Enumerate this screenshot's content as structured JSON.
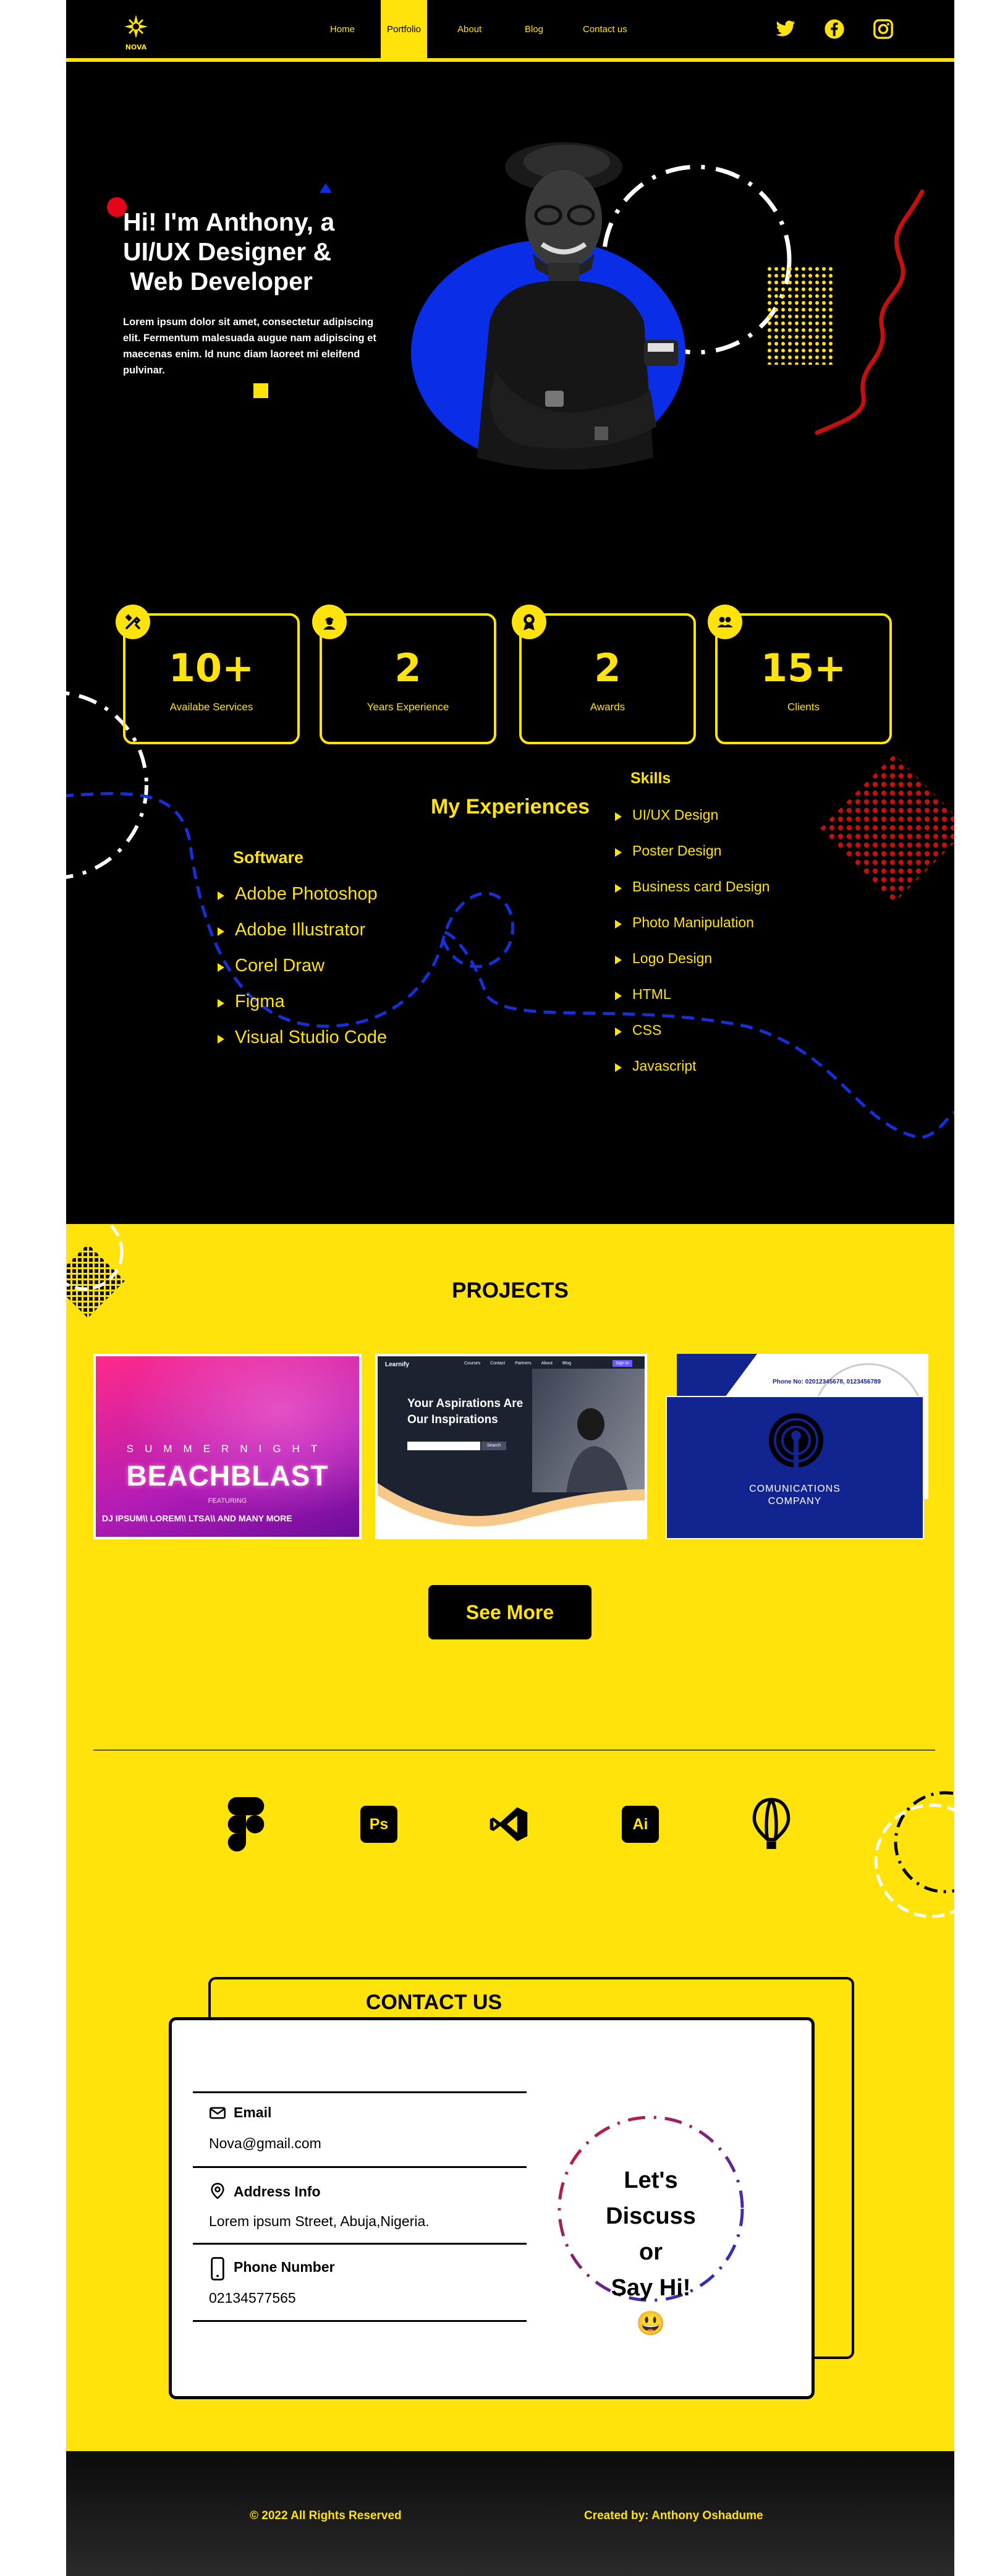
{
  "brand": {
    "name": "NOVA"
  },
  "nav": {
    "items": [
      {
        "label": "Home"
      },
      {
        "label": "Portfolio"
      },
      {
        "label": "About"
      },
      {
        "label": "Blog"
      },
      {
        "label": "Contact us"
      }
    ],
    "active": "Portfolio",
    "social": [
      "twitter-icon",
      "facebook-icon",
      "instagram-icon"
    ]
  },
  "hero": {
    "title_lines": [
      "Hi! I'm Anthony, a",
      "UI/UX Designer &",
      " Web Developer"
    ],
    "description": "Lorem ipsum dolor sit amet, consectetur adipiscing elit. Fermentum malesuada augue nam adipiscing et maecenas enim. Id nunc diam laoreet mi eleifend pulvinar."
  },
  "stats": [
    {
      "value": "10+",
      "label": "Availabe Services",
      "icon": "tools-icon"
    },
    {
      "value": "2",
      "label": "Years Experience",
      "icon": "worker-icon"
    },
    {
      "value": "2",
      "label": "Awards",
      "icon": "award-icon"
    },
    {
      "value": "15+",
      "label": "Clients",
      "icon": "clients-icon"
    }
  ],
  "experiences": {
    "title": "My Experiences",
    "software_title": "Software",
    "software": [
      "Adobe Photoshop",
      "Adobe Illustrator",
      "Corel Draw",
      "Figma",
      "Visual Studio Code"
    ],
    "skills_title": "Skills",
    "skills": [
      "UI/UX Design",
      "Poster Design",
      "Business card Design",
      "Photo Manipulation",
      "Logo Design",
      "HTML",
      "CSS",
      "Javascript"
    ]
  },
  "projects": {
    "title": "PROJECTS",
    "cards": [
      {
        "type": "poster",
        "top_text": "SUMMERNIGHT",
        "main_text": "BEACHBLAST",
        "featuring": "FEATURING",
        "bottom_text": "DJ IPSUM\\\\ LOREM\\\\ LTSA\\\\ AND MANY MORE"
      },
      {
        "type": "website",
        "brand": "Learnify",
        "menu": [
          "Courses",
          "Contact",
          "Partners",
          "About",
          "Blog"
        ],
        "sign_in": "Sign In",
        "headline_1": "Your Aspirations Are",
        "headline_2": "Our Inspirations",
        "search_label": "Search"
      },
      {
        "type": "business-card",
        "phone": "Phone No: 02012345678, 0123456789",
        "company_1": "COMUNICATIONS",
        "company_2": "COMPANY"
      }
    ],
    "see_more": "See More",
    "tools": [
      "figma-icon",
      "photoshop-icon",
      "vscode-icon",
      "illustrator-icon",
      "coreldraw-icon"
    ],
    "tool_labels": {
      "photoshop": "Ps",
      "illustrator": "Ai"
    }
  },
  "contact": {
    "title": "CONTACT US",
    "email_label": "Email",
    "email_value": "Nova@gmail.com",
    "address_label": "Address Info",
    "address_value": "Lorem ipsum Street, Abuja,Nigeria.",
    "phone_label": "Phone Number",
    "phone_value": "02134577565",
    "discuss_lines": [
      "Let's Discuss",
      "or",
      "Say Hi!"
    ],
    "emoji": "😃"
  },
  "footer": {
    "copyright": "© 2022 All Rights Reserved",
    "credit": "Created by: Anthony Oshadume"
  },
  "colors": {
    "accent": "#ffe30a",
    "dark": "#000000",
    "blue": "#0a2ee8",
    "red": "#c40f0f"
  }
}
